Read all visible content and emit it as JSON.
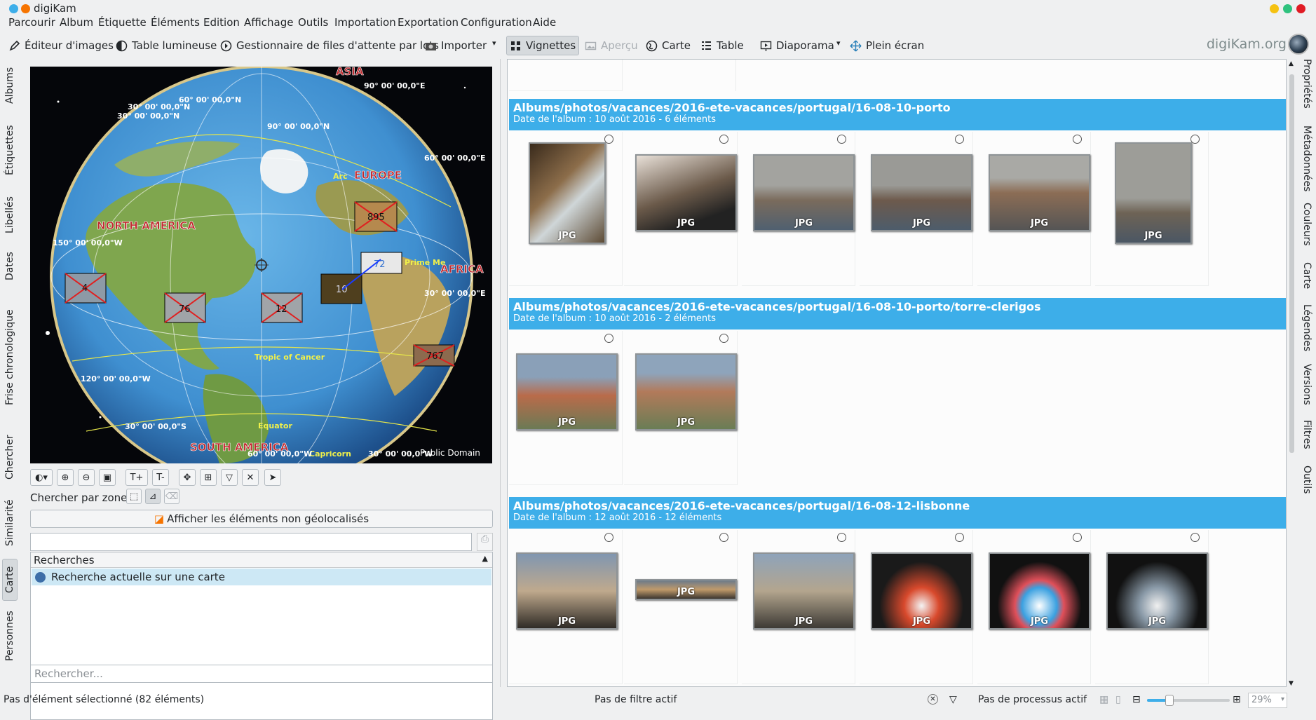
{
  "window": {
    "title": "digiKam"
  },
  "menu": [
    "Parcourir",
    "Album",
    "Étiquette",
    "Éléments",
    "Edition",
    "Affichage",
    "Outils",
    "Importation",
    "Exportation",
    "Configuration",
    "Aide"
  ],
  "toolbar": {
    "editor": "Éditeur d'images",
    "light_table": "Table lumineuse",
    "batch": "Gestionnaire de files d'attente par lots",
    "import": "Importer",
    "thumbnails": "Vignettes",
    "preview": "Aperçu",
    "map": "Carte",
    "table": "Table",
    "slideshow": "Diaporama",
    "fullscreen": "Plein écran",
    "brand": "digiKam.org"
  },
  "left_tabs": [
    "Albums",
    "Étiquettes",
    "Libellés",
    "Dates",
    "Frise chronologique",
    "Chercher",
    "Similarité",
    "Carte",
    "Personnes"
  ],
  "right_tabs": [
    "Propriétés",
    "Métadonnées",
    "Couleurs",
    "Carte",
    "Légendes",
    "Versions",
    "Filtres",
    "Outils"
  ],
  "map": {
    "labels": {
      "asia": "ASIA",
      "europe": "EUROPE",
      "north_america": "NORTH AMERICA",
      "south_america": "SOUTH AMERICA",
      "africa": "AFRICA",
      "tropic_cancer": "Tropic of Cancer",
      "equator": "Equator",
      "prime": "Prime Me",
      "arc": "Arc",
      "public_domain": "Public Domain"
    },
    "coords": {
      "c1": "90° 00' 00,0\"E",
      "c2": "60° 00' 00,0\"N",
      "c3": "30° 00' 00,0\"N",
      "c4": "30° 00' 00,0\"N",
      "c5": "90° 00' 00,0\"N",
      "c6": "60° 00' 00,0\"E",
      "c7": "150° 00' 00,0\"W",
      "c8": "30° 00' 00,0\"E",
      "c9": "120° 00' 00,0\"W",
      "c10": "30° 00' 00,0\"S",
      "c11": "60° 00' 00,0\"W",
      "c12": "30° 00' 00,0\"W",
      "c13": "Capricorn"
    },
    "clusters": {
      "k895": "895",
      "k72": "72",
      "k4": "4",
      "k76": "76",
      "k12": "12",
      "k10": "10",
      "k767": "767"
    }
  },
  "map_panel": {
    "zone_label": "Chercher par zone :",
    "show_ungeolocated": "Afficher les éléments non géolocalisés",
    "searches_header": "Recherches",
    "current_search": "Recherche actuelle sur une carte",
    "filter_placeholder": "Rechercher...",
    "tb_text_plus": "T+",
    "tb_text_minus": "T-"
  },
  "albums": [
    {
      "path": "Albums/photos/vacances/2016-ete-vacances/portugal/16-08-10-porto",
      "subtitle": "Date de l'album : 10 août 2016 - 6 éléments"
    },
    {
      "path": "Albums/photos/vacances/2016-ete-vacances/portugal/16-08-10-porto/torre-clerigos",
      "subtitle": "Date de l'album : 10 août 2016 - 2 éléments"
    },
    {
      "path": "Albums/photos/vacances/2016-ete-vacances/portugal/16-08-12-lisbonne",
      "subtitle": "Date de l'album : 12 août 2016 - 12 éléments"
    }
  ],
  "thumb_label": "JPG",
  "status": {
    "selection": "Pas d'élément sélectionné (82 éléments)",
    "filter": "Pas de filtre actif",
    "process": "Pas de processus actif",
    "zoom": "29%"
  }
}
